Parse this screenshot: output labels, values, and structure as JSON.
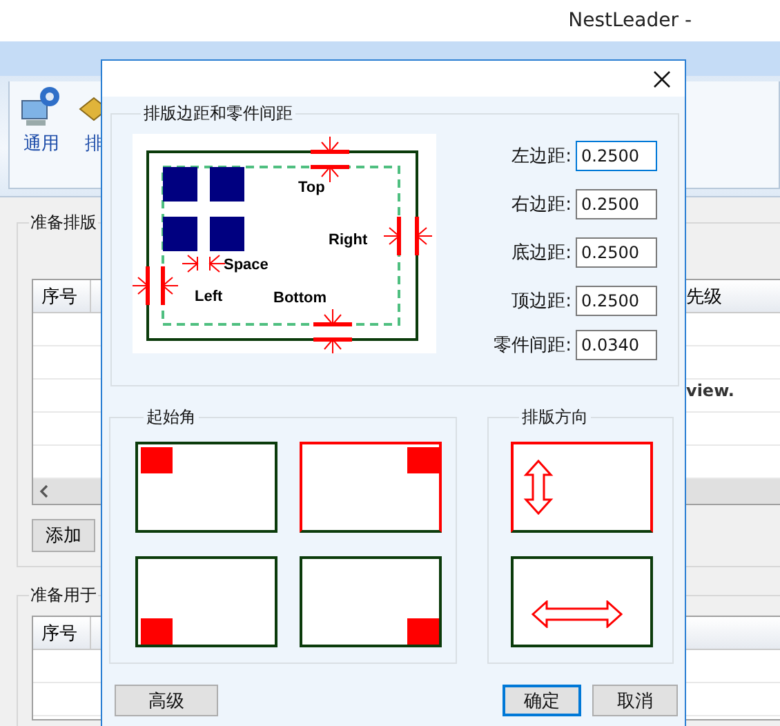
{
  "app": {
    "title": "NestLeader -",
    "toolbar": [
      {
        "label": "通用",
        "kind": "gear"
      },
      {
        "label": "排",
        "kind": "diamond"
      }
    ],
    "group_1": {
      "title": "准备排版",
      "columns": [
        "序号",
        "先级"
      ],
      "note": "view.",
      "add_button": "添加"
    },
    "group_2": {
      "title": "准备用于",
      "columns": [
        "序号"
      ]
    }
  },
  "dialog": {
    "margins": {
      "title": "排版边距和零件间距",
      "diagram_labels": {
        "top": "Top",
        "right": "Right",
        "space": "Space",
        "left": "Left",
        "bottom": "Bottom"
      },
      "fields": [
        {
          "label": "左边距:",
          "value": "0.2500",
          "focused": true
        },
        {
          "label": "右边距:",
          "value": "0.2500",
          "focused": false
        },
        {
          "label": "底边距:",
          "value": "0.2500",
          "focused": false
        },
        {
          "label": "顶边距:",
          "value": "0.2500",
          "focused": false
        },
        {
          "label": "零件间距:",
          "value": "0.0340",
          "focused": false
        }
      ]
    },
    "start_corner": {
      "title": "起始角",
      "options": [
        {
          "kind": "top-left",
          "selected": false
        },
        {
          "kind": "top-right",
          "selected": true
        },
        {
          "kind": "bottom-left",
          "selected": false
        },
        {
          "kind": "bottom-right",
          "selected": false
        }
      ]
    },
    "direction": {
      "title": "排版方向",
      "options": [
        {
          "kind": "vertical",
          "selected": true
        },
        {
          "kind": "horizontal",
          "selected": false
        }
      ]
    },
    "buttons": [
      {
        "label": "高级",
        "default": false
      },
      {
        "label": "确定",
        "default": true
      },
      {
        "label": "取消",
        "default": false
      }
    ]
  }
}
